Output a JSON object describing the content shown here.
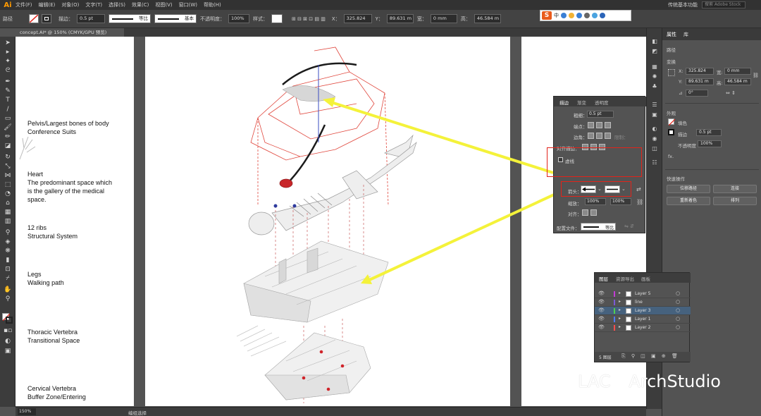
{
  "app": {
    "logo": "Ai",
    "menu": [
      "文件(F)",
      "编辑(E)",
      "对象(O)",
      "文字(T)",
      "选择(S)",
      "效果(C)",
      "视图(V)",
      "窗口(W)",
      "帮助(H)"
    ],
    "workspace": "传统基本功能",
    "search_placeholder": "搜索 Adobe Stock"
  },
  "control_bar": {
    "path_label": "路径",
    "stroke_label": "描边：",
    "stroke_value": "0.5 pt",
    "profile_label": "等比",
    "brush_label": "基本",
    "opacity_label": "不透明度：",
    "opacity_value": "100%",
    "style_label": "样式：",
    "x_label": "X：",
    "x_value": "325.824",
    "y_label": "Y：",
    "y_value": "89.631 m",
    "w_label": "宽：",
    "w_value": "0 mm",
    "h_label": "高：",
    "h_value": "46.584 m"
  },
  "ime": {
    "logo": "S",
    "mode": "中"
  },
  "document": {
    "tab_title": "concept.AI* @ 150% (CMYK/GPU 预览)"
  },
  "artboard_labels": [
    {
      "lines": [
        "Pelvis/Largest bones of body",
        "Conference Suits"
      ]
    },
    {
      "lines": [
        "Heart",
        "The predominant space which",
        "is the gallery of the medical",
        "space."
      ]
    },
    {
      "lines": [
        "12 ribs",
        "Structural System"
      ]
    },
    {
      "lines": [
        "Legs",
        "Walking path"
      ]
    },
    {
      "lines": [
        "Thoracic Vertebra",
        "Transitional Space"
      ]
    },
    {
      "lines": [
        "Cervical Vertebra",
        "Buffer Zone/Entering"
      ]
    }
  ],
  "properties_panel": {
    "tabs": [
      "属性",
      "库"
    ],
    "section_path": "路径",
    "section_transform": "变换",
    "x": "325.824",
    "y": "89.631 m",
    "w": "0 mm",
    "h": "46.584 m",
    "angle": "0°",
    "section_appearance": "外观",
    "fill_label": "填色",
    "stroke_label": "描边",
    "stroke_value": "0.5 pt",
    "opacity_label": "不透明度",
    "opacity_value": "100%",
    "fx_label": "fx.",
    "section_quick": "快速操作",
    "btn_offset": "位移路径",
    "btn_join": "连接",
    "btn_recolor": "重新着色",
    "btn_arrange": "排列"
  },
  "stroke_panel": {
    "tabs": [
      "描边",
      "渐变",
      "透明度"
    ],
    "weight_label": "粗细：",
    "weight_value": "0.5 pt",
    "cap_label": "端点：",
    "corner_label": "边角：",
    "limit_label": "限制：",
    "align_label": "对齐描边：",
    "dashed_label": "虚线",
    "arrow_label": "箭头：",
    "scale_label": "缩放：",
    "scale_start": "100%",
    "scale_end": "100%",
    "align2_label": "对齐：",
    "profile_label": "配置文件：",
    "profile_value": "等比"
  },
  "layers_panel": {
    "tabs": [
      "图层",
      "资源导出",
      "画板"
    ],
    "layers": [
      {
        "name": "Layer 5",
        "color": "#c23bd4"
      },
      {
        "name": "line",
        "color": "#7a5bd6"
      },
      {
        "name": "Layer 3",
        "color": "#4fd14f",
        "selected": true
      },
      {
        "name": "Layer 1",
        "color": "#4d7cff"
      },
      {
        "name": "Layer 2",
        "color": "#ff4d4d"
      }
    ],
    "count_label": "5 图层"
  },
  "status_bar": {
    "zoom": "150%",
    "mode": "编组选择"
  },
  "watermark": {
    "text_a": "LAC",
    "text_b": "ArchStudio"
  }
}
